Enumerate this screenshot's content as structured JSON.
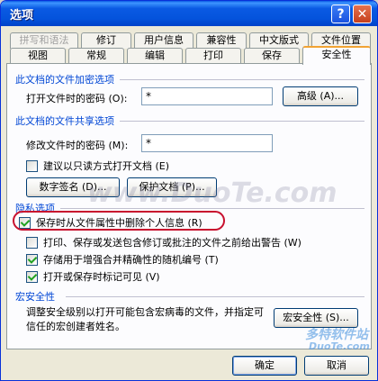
{
  "window": {
    "title": "选项"
  },
  "tabs_row1": [
    {
      "label": "拼写和语法",
      "disabled": true
    },
    {
      "label": "修订"
    },
    {
      "label": "用户信息"
    },
    {
      "label": "兼容性"
    },
    {
      "label": "中文版式"
    },
    {
      "label": "文件位置"
    }
  ],
  "tabs_row2": [
    {
      "label": "视图"
    },
    {
      "label": "常规"
    },
    {
      "label": "编辑"
    },
    {
      "label": "打印"
    },
    {
      "label": "保存"
    },
    {
      "label": "安全性",
      "active": true
    }
  ],
  "encrypt": {
    "section_title": "此文档的文件加密选项",
    "open_password_label": "打开文件时的密码 (O):",
    "open_password_value": "*",
    "advanced_button": "高级 (A)..."
  },
  "share": {
    "section_title": "此文档的文件共享选项",
    "modify_password_label": "修改文件时的密码 (M):",
    "modify_password_value": "*",
    "readonly_checkbox": {
      "label": "建议以只读方式打开文档 (E)",
      "checked": false
    },
    "digital_sign_button": "数字签名 (D)...",
    "protect_doc_button": "保护文档 (P)..."
  },
  "privacy": {
    "section_title": "隐私选项",
    "options": [
      {
        "label": "保存时从文件属性中删除个人信息 (R)",
        "checked": true
      },
      {
        "label": "打印、保存或发送包含修订或批注的文件之前给出警告 (W)",
        "checked": false
      },
      {
        "label": "存储用于增强合并精确性的随机编号 (T)",
        "checked": true
      },
      {
        "label": "打开或保存时标记可见 (V)",
        "checked": true
      }
    ]
  },
  "macro": {
    "section_title": "宏安全性",
    "description": "调整安全级别以打开可能包含宏病毒的文件，并指定可信任的宏创建者姓名。",
    "macro_button": "宏安全性 (S)..."
  },
  "footer": {
    "ok_button": "确定",
    "cancel_button": "取消"
  },
  "watermarks": {
    "center": "www.DuoTe.com",
    "logo": "多特软件站",
    "logo_site": "DuoTe.com"
  }
}
